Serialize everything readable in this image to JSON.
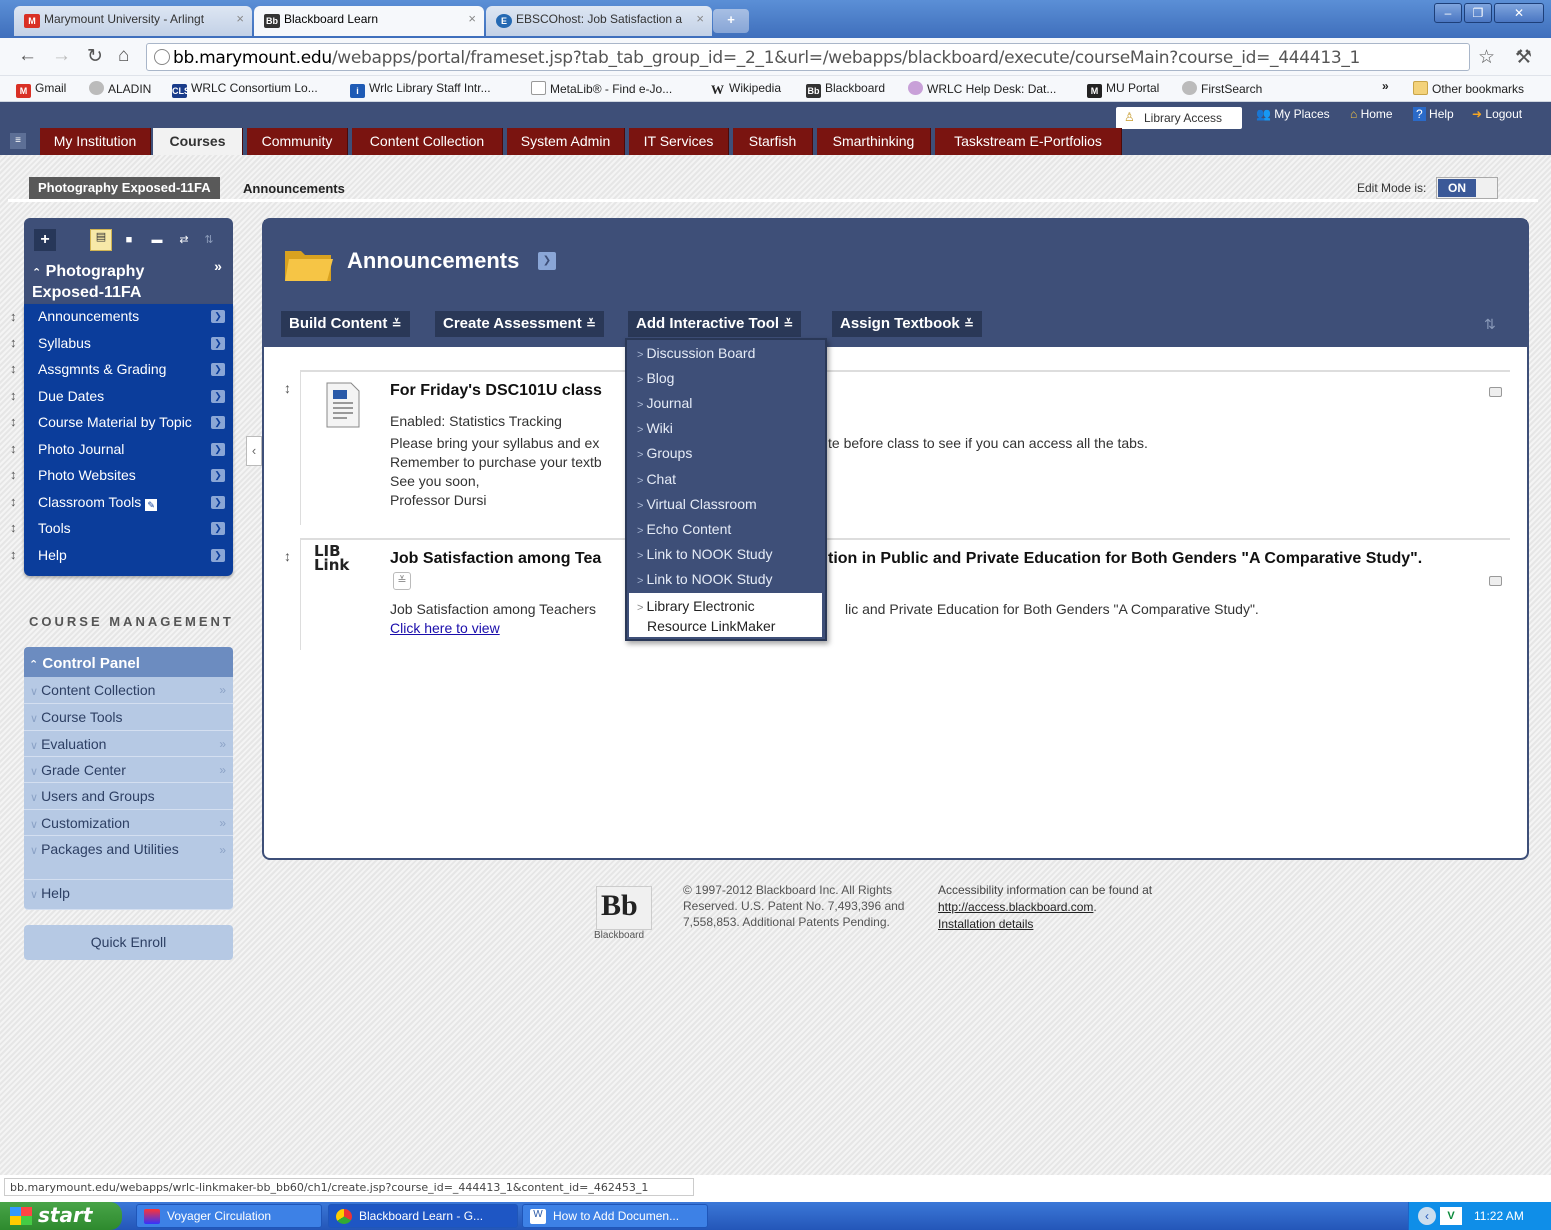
{
  "browser": {
    "tabs": [
      {
        "label": "Marymount University - Arlingt",
        "icon": "gmail-icon"
      },
      {
        "label": "Blackboard Learn",
        "icon": "blackboard-icon"
      },
      {
        "label": "EBSCOhost: Job Satisfaction a",
        "icon": "ebsco-icon"
      }
    ],
    "url_domain": "bb.marymount.edu",
    "url_path": "/webapps/portal/frameset.jsp?tab_tab_group_id=_2_1&url=/webapps/blackboard/execute/courseMain?course_id=_444413_1",
    "bookmarks": [
      "Gmail",
      "ALADIN",
      "WRLC Consortium Lo...",
      "Wrlc Library Staff Intr...",
      "MetaLib® - Find e-Jo...",
      "Wikipedia",
      "Blackboard",
      "WRLC Help Desk: Dat...",
      "MU Portal",
      "FirstSearch"
    ],
    "more_bookmarks": "»",
    "other_bookmarks": "Other bookmarks",
    "status_url": "bb.marymount.edu/webapps/wrlc-linkmaker-bb_bb60/ch1/create.jsp?course_id=_444413_1&content_id=_462453_1"
  },
  "bb_header": {
    "library_access": "Library Access",
    "tools": [
      "My Places",
      "Home",
      "Help",
      "Logout"
    ],
    "tabs": [
      "My Institution",
      "Courses",
      "Community",
      "Content Collection",
      "System Admin",
      "IT Services",
      "Starfish",
      "Smarthinking",
      "Taskstream E-Portfolios"
    ],
    "active_tab": "Courses"
  },
  "breadcrumb": {
    "course": "Photography Exposed-11FA",
    "current": "Announcements",
    "edit_mode_label": "Edit Mode is:",
    "edit_mode_value": "ON"
  },
  "course_menu": {
    "title": "Photography Exposed-11FA",
    "items": [
      "Announcements",
      "Syllabus",
      "Assgmnts & Grading",
      "Due Dates",
      "Course Material by Topic",
      "Photo Journal",
      "Photo Websites",
      "Classroom Tools",
      "Tools",
      "Help"
    ]
  },
  "course_management": {
    "heading": "COURSE MANAGEMENT",
    "panel": "Control Panel",
    "items": [
      "Content Collection",
      "Course Tools",
      "Evaluation",
      "Grade Center",
      "Users and Groups",
      "Customization",
      "Packages and Utilities",
      "Help"
    ],
    "quick_enroll": "Quick Enroll"
  },
  "content": {
    "title": "Announcements",
    "actions": [
      "Build Content",
      "Create Assessment",
      "Add Interactive Tool",
      "Assign Textbook"
    ],
    "item1": {
      "title": "For Friday's DSC101U class",
      "status": "Enabled:  Statistics Tracking",
      "line1a": "Please bring your syllabus and ex",
      "line1b": "te before class to see if you can access all the tabs.",
      "line2": "Remember to purchase your textb",
      "line3": "See you soon,",
      "line4": "Professor Dursi"
    },
    "item2": {
      "title_a": "Job Satisfaction among Tea",
      "title_b": "tion in Public and Private Education for Both Genders \"A Comparative Study\".",
      "text_a": "Job Satisfaction among Teachers",
      "text_b": "lic and Private Education for Both Genders \"A Comparative Study\".",
      "link": "Click here to view",
      "icon_label": "LIB Link"
    }
  },
  "dropdown": {
    "items": [
      "Discussion Board",
      "Blog",
      "Journal",
      "Wiki",
      "Groups",
      "Chat",
      "Virtual Classroom",
      "Echo Content",
      "Link to NOOK Study",
      "Link to NOOK Study"
    ],
    "highlighted_line1": "Library Electronic",
    "highlighted_line2": "Resource LinkMaker"
  },
  "footer": {
    "logo": "Bb",
    "logo_label": "Blackboard",
    "copyright": "© 1997-2012 Blackboard Inc. All Rights Reserved. U.S. Patent No. 7,493,396 and 7,558,853. Additional Patents Pending.",
    "access_text": "Accessibility information can be found at",
    "access_link": "http://access.blackboard.com",
    "install_link": "Installation details"
  },
  "taskbar": {
    "start": "start",
    "tasks": [
      "Voyager Circulation",
      "Blackboard Learn - G...",
      "How to Add Documen..."
    ],
    "clock": "11:22 AM"
  }
}
